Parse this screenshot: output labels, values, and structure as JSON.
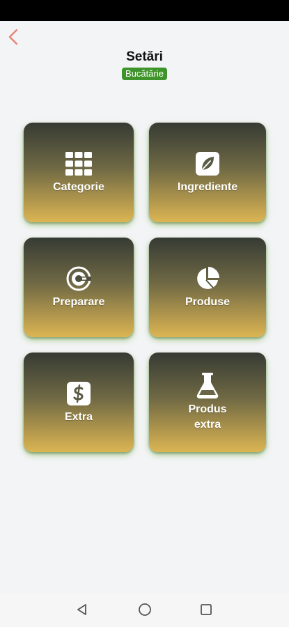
{
  "header": {
    "title": "Setări",
    "badge": "Bucătărie"
  },
  "tiles": [
    {
      "label": "Categorie",
      "icon": "grid-icon"
    },
    {
      "label": "Ingrediente",
      "icon": "leaf-icon"
    },
    {
      "label": "Preparare",
      "icon": "chef-icon"
    },
    {
      "label": "Produse",
      "icon": "pie-chart-icon"
    },
    {
      "label": "Extra",
      "icon": "dollar-sign-icon"
    },
    {
      "label": "Produs extra",
      "icon": "flask-icon"
    }
  ],
  "colors": {
    "accent_back": "#e8847a",
    "badge_bg": "#3e9428",
    "tile_top": "#363b33",
    "tile_bottom": "#dcb553"
  }
}
